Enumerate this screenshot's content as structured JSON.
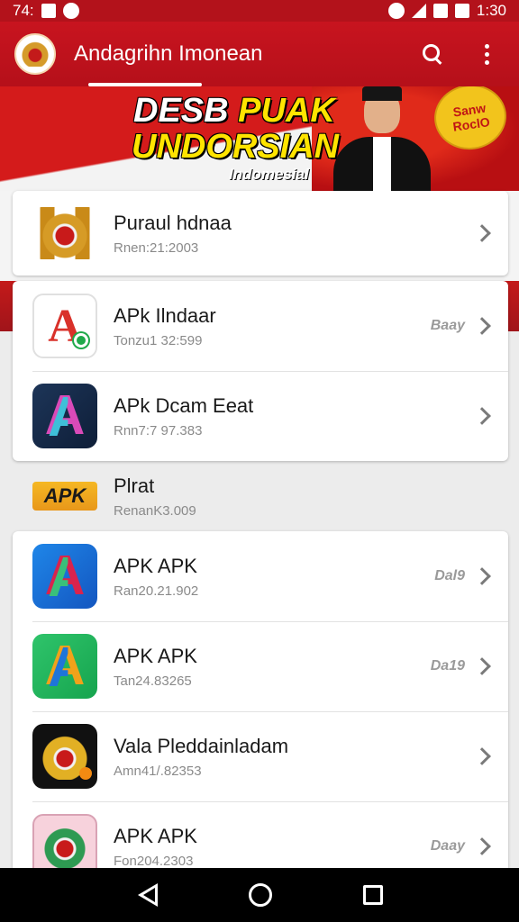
{
  "status_bar": {
    "time_left": "74:",
    "time_right": "1:30"
  },
  "app_bar": {
    "title": "Andagrihn Imonean"
  },
  "banner": {
    "line1_white": "DESB ",
    "line1_yellow": "PUAK",
    "line2": "UNDORSIAN",
    "line3": "Indomesial",
    "badge_line1": "Sanw",
    "badge_line2": "RoclO"
  },
  "featured": {
    "title": "Puraul hdnaa",
    "subtitle": "Rnen:21:2003"
  },
  "group1": [
    {
      "title": "APk Ilndaar",
      "subtitle": "Tonzu1 32:599",
      "tag": "Baay"
    },
    {
      "title": "APk Dcam Eeat",
      "subtitle": "Rnn7:7 97.383",
      "tag": ""
    }
  ],
  "plain": {
    "badge": "APK",
    "title": "Plrat",
    "subtitle": "RenanK3.009"
  },
  "group2": [
    {
      "title": "APK  APK",
      "subtitle": "Ran20.21.902",
      "tag": "Dal9"
    },
    {
      "title": "APK APK",
      "subtitle": "Tan24.83265",
      "tag": "Da19"
    },
    {
      "title": "Vala Pleddainladam",
      "subtitle": "Amn41/.82353",
      "tag": ""
    },
    {
      "title": "APK APK",
      "subtitle": "Fon204.2303",
      "tag": "Daay"
    }
  ],
  "icons": {
    "search": "search-icon",
    "more": "more-vert-icon",
    "chevron": "chevron-right-icon"
  },
  "colors": {
    "primary": "#c8141f",
    "accent_yellow": "#ffe400"
  }
}
